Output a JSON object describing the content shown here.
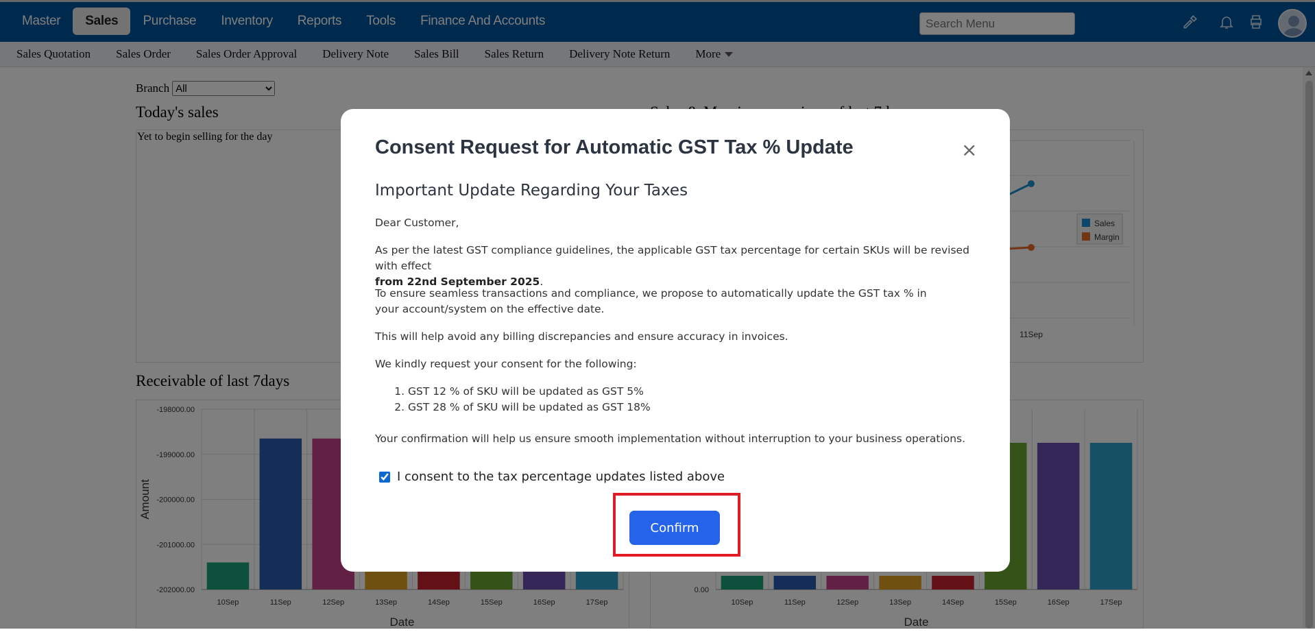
{
  "topnav": {
    "items": [
      "Master",
      "Sales",
      "Purchase",
      "Inventory",
      "Reports",
      "Tools",
      "Finance And Accounts"
    ],
    "active": "Sales",
    "search_placeholder": "Search Menu"
  },
  "subnav": {
    "items": [
      "Sales Quotation",
      "Sales Order",
      "Sales Order Approval",
      "Delivery Note",
      "Sales Bill",
      "Sales Return",
      "Delivery Note Return",
      "More"
    ]
  },
  "dashboard": {
    "branch_label": "Branch",
    "branch_value": "All",
    "todays_sales_title": "Today's sales",
    "todays_sales_text": "Yet to begin selling for the day",
    "sales_margin_title": "Sales & Margin comparison of last 7days",
    "receivable_title": "Receivable of last 7days"
  },
  "modal": {
    "title": "Consent Request for Automatic GST Tax % Update",
    "close_label": "×",
    "subtitle": "Important Update Regarding Your Taxes",
    "greeting": "Dear Customer,",
    "para1": "As per the latest GST compliance guidelines, the applicable GST tax percentage for certain SKUs will be revised with effect",
    "para1_bold": "from 22nd September 2025",
    "para1_end": ".",
    "para2": "To ensure seamless transactions and compliance, we propose to automatically update the GST tax % in your account/system on the effective date.",
    "para3": "This will help avoid any billing discrepancies and ensure accuracy in invoices.",
    "para4": "We kindly request your consent for the following:",
    "list": [
      "GST 12 % of SKU will be updated as GST 5%",
      "GST 28 % of SKU will be updated as GST 18%"
    ],
    "para5": "Your confirmation will help us ensure smooth implementation without interruption to your business operations.",
    "consent_label": "I consent to the tax percentage updates listed above",
    "consent_checked": true,
    "confirm_label": "Confirm"
  },
  "colors": {
    "topbar": "#00539c",
    "confirm": "#2563eb",
    "highlight": "#e01b24"
  },
  "chart_data": [
    {
      "type": "bar",
      "categories": [
        "10Sep",
        "11Sep",
        "12Sep",
        "13Sep",
        "14Sep",
        "15Sep",
        "16Sep",
        "17Sep"
      ],
      "values": [
        -201400,
        -198650,
        -198650,
        -198650,
        -198650,
        -198650,
        -198650,
        -198650
      ],
      "yticks": [
        "-198000.00",
        "-199000.00",
        "-200000.00",
        "-201000.00",
        "-202000.00"
      ],
      "ylim": [
        -202000,
        -198000
      ],
      "xlabel": "Date",
      "ylabel": "Amount",
      "colors": [
        "#1aa37a",
        "#2a5db0",
        "#c4408a",
        "#e0a020",
        "#c8202f",
        "#6aa632",
        "#6a4eb0",
        "#2aa0c8"
      ]
    },
    {
      "type": "bar",
      "categories": [
        "10Sep",
        "11Sep",
        "12Sep",
        "13Sep",
        "14Sep",
        "15Sep",
        "16Sep",
        "17Sep"
      ],
      "yticks": [
        "0.00"
      ],
      "xlabel": "Date",
      "colors": [
        "#1aa37a",
        "#2a5db0",
        "#c4408a",
        "#e0a020",
        "#c8202f",
        "#6aa632",
        "#6a4eb0",
        "#2aa0c8"
      ]
    },
    {
      "type": "line",
      "x": [
        "11Sep"
      ],
      "series": [
        {
          "name": "Sales"
        },
        {
          "name": "Margin"
        }
      ],
      "legend": "right",
      "colors": [
        "#1a90d0",
        "#e86a28"
      ]
    }
  ]
}
